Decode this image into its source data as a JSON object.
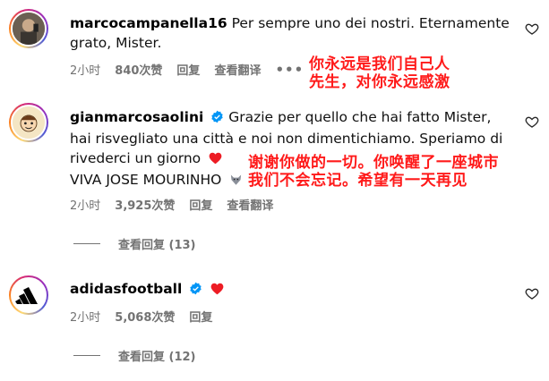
{
  "comments": [
    {
      "username": "marcocampanella16",
      "text": "Per sempre uno dei nostri. Eternamente grato, Mister.",
      "time": "2小时",
      "likes": "840次赞",
      "reply": "回复",
      "translate": "查看翻译",
      "more": "•••",
      "overlay_line1": "你永远是我们自己人",
      "overlay_line2": "先生，对你永远感激"
    },
    {
      "username": "gianmarcosaolini",
      "text": "Grazie per quello che hai fatto Mister, hai risvegliato una città e noi non dimentichiamo. Speriamo di rivederci un giorno",
      "text2": "VIVA JOSE MOURINHO",
      "time": "2小时",
      "likes": "3,925次赞",
      "reply": "回复",
      "translate": "查看翻译",
      "view_replies": "查看回复 (13)",
      "overlay_line1": "谢谢你做的一切。你唤醒了一座城市",
      "overlay_line2": "我们不会忘记。希望有一天再见"
    },
    {
      "username": "adidasfootball",
      "time": "2小时",
      "likes": "5,068次赞",
      "reply": "回复",
      "view_replies": "查看回复 (12)"
    }
  ],
  "colors": {
    "verified": "#0095f6",
    "heart": "#ed1c24",
    "meta_text": "#737373",
    "overlay": "#ff1a1a"
  }
}
